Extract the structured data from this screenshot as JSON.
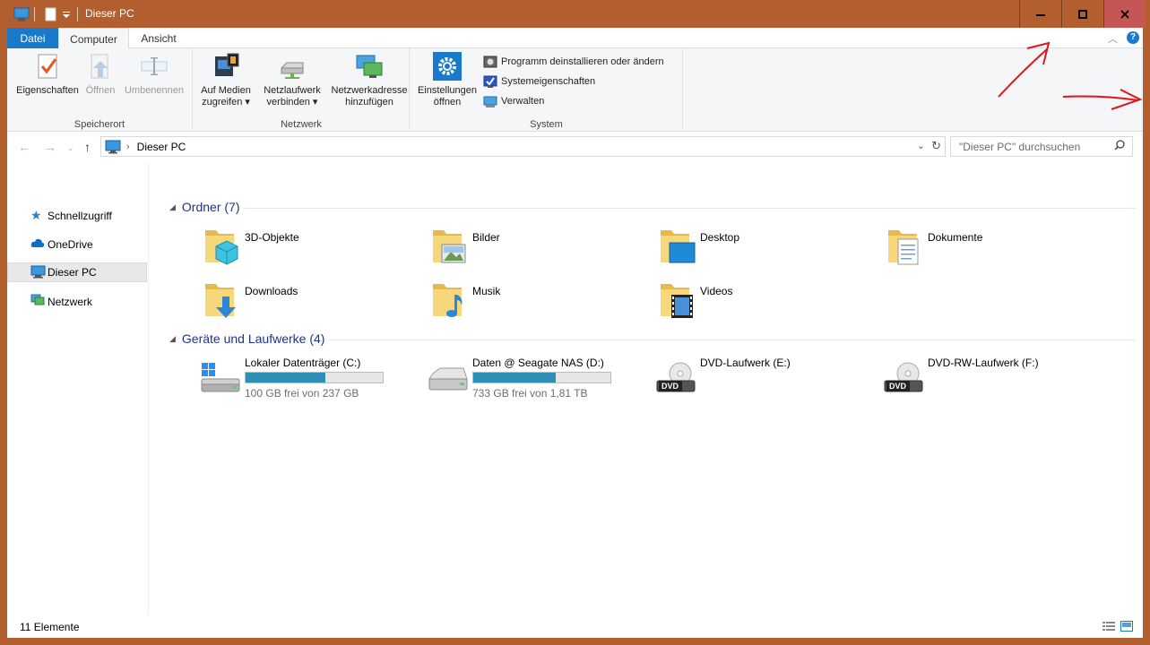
{
  "window": {
    "title": "Dieser PC",
    "frame_color": "#b35e2e",
    "controls": {
      "minimize": "minimize-icon",
      "maximize": "maximize-icon",
      "close": "close-icon"
    }
  },
  "ribbon": {
    "tabs": [
      "Datei",
      "Computer",
      "Ansicht"
    ],
    "groups": {
      "speicherort": {
        "label": "Speicherort",
        "buttons": [
          "Eigenschaften",
          "Öffnen",
          "Umbenennen"
        ]
      },
      "netzwerk": {
        "label": "Netzwerk",
        "buttons": [
          {
            "line1": "Auf Medien",
            "line2": "zugreifen"
          },
          {
            "line1": "Netzlaufwerk",
            "line2": "verbinden"
          },
          {
            "line1": "Netzwerkadresse",
            "line2": "hinzufügen"
          }
        ]
      },
      "system": {
        "label": "System",
        "settings": {
          "line1": "Einstellungen",
          "line2": "öffnen"
        },
        "small_buttons": [
          "Programm deinstallieren oder ändern",
          "Systemeigenschaften",
          "Verwalten"
        ]
      }
    }
  },
  "address": {
    "path": "Dieser PC",
    "search_placeholder": "\"Dieser PC\" durchsuchen"
  },
  "nav_pane": {
    "items": [
      "Schnellzugriff",
      "OneDrive",
      "Dieser PC",
      "Netzwerk"
    ]
  },
  "content": {
    "folders_header": "Ordner (7)",
    "folders": [
      "3D-Objekte",
      "Bilder",
      "Desktop",
      "Dokumente",
      "Downloads",
      "Musik",
      "Videos"
    ],
    "drives_header": "Geräte und Laufwerke (4)",
    "drives": [
      {
        "name": "Lokaler Datenträger (C:)",
        "free": "100 GB frei von 237 GB",
        "used_fraction": 0.58
      },
      {
        "name": "Daten @ Seagate NAS (D:)",
        "free": "733 GB frei von 1,81 TB",
        "used_fraction": 0.6
      },
      {
        "name": "DVD-Laufwerk (E:)"
      },
      {
        "name": "DVD-RW-Laufwerk (F:)"
      }
    ],
    "dvd_label": "DVD"
  },
  "status": {
    "count": "11 Elemente"
  }
}
